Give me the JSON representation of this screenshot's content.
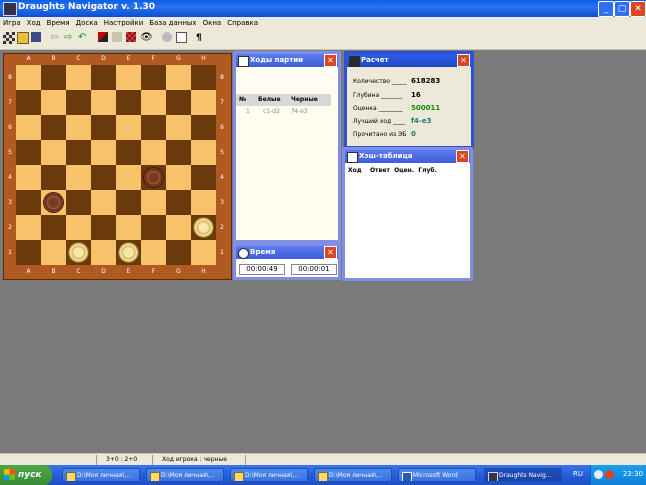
{
  "window": {
    "title": "Draughts Navigator v. 1.30"
  },
  "menu": [
    "Игра",
    "Ход",
    "Время",
    "Доска",
    "Настройки",
    "База данных",
    "Окна",
    "Справка"
  ],
  "board": {
    "files": [
      "A",
      "B",
      "C",
      "D",
      "E",
      "F",
      "G",
      "H"
    ],
    "ranks": [
      "8",
      "7",
      "6",
      "5",
      "4",
      "3",
      "2",
      "1"
    ],
    "pieces": [
      {
        "square": "f4",
        "color": "black"
      },
      {
        "square": "b3",
        "color": "black"
      },
      {
        "square": "h2",
        "color": "white"
      },
      {
        "square": "c1",
        "color": "white"
      },
      {
        "square": "e1",
        "color": "white"
      }
    ]
  },
  "moves_panel": {
    "title": "Ходы партии",
    "headers": [
      "№",
      "Белые",
      "Черные"
    ],
    "rows": [
      {
        "n": "1",
        "white": "c1-d2",
        "black": "f4-e3"
      }
    ]
  },
  "calc_panel": {
    "title": "Расчет",
    "rows": [
      {
        "label": "Количество _____",
        "value": "618283",
        "color": "#000000"
      },
      {
        "label": "Глубина _______",
        "value": "16",
        "color": "#000000"
      },
      {
        "label": "Оценка ________",
        "value": "500011",
        "color": "#0a8a0a"
      },
      {
        "label": "Лучший ход ____",
        "value": "f4-e3",
        "color": "#1a7a7a"
      },
      {
        "label": "Прочитано из ЭБ",
        "value": "0",
        "color": "#1a7a7a"
      }
    ]
  },
  "hash_panel": {
    "title": "Хэш-таблица",
    "columns": [
      "Ход",
      "Ответ",
      "Оцен.",
      "Глуб."
    ]
  },
  "time_panel": {
    "title": "Время",
    "white_time": "00:00:49",
    "black_time": "00:00:01"
  },
  "status": {
    "score": "3+0 : 2+0",
    "turn": "Ход игрока : черные"
  },
  "taskbar": {
    "start": "пуск",
    "tasks": [
      {
        "label": "D:\\Моя личная\\...",
        "active": false
      },
      {
        "label": "D:\\Моя личная\\...",
        "active": false
      },
      {
        "label": "D:\\Моя личная\\...",
        "active": false
      },
      {
        "label": "D:\\Моя личная\\...",
        "active": false
      },
      {
        "label": "Microsoft Word",
        "active": false
      },
      {
        "label": "Draughts Navig...",
        "active": true
      }
    ],
    "lang": "RU",
    "clock": "23:30"
  },
  "colors": {
    "titlebar": "#0a5fe8",
    "light_square": "#f8c26a",
    "dark_square": "#6a3a0c",
    "panel_frame": "#7f8fe8"
  }
}
